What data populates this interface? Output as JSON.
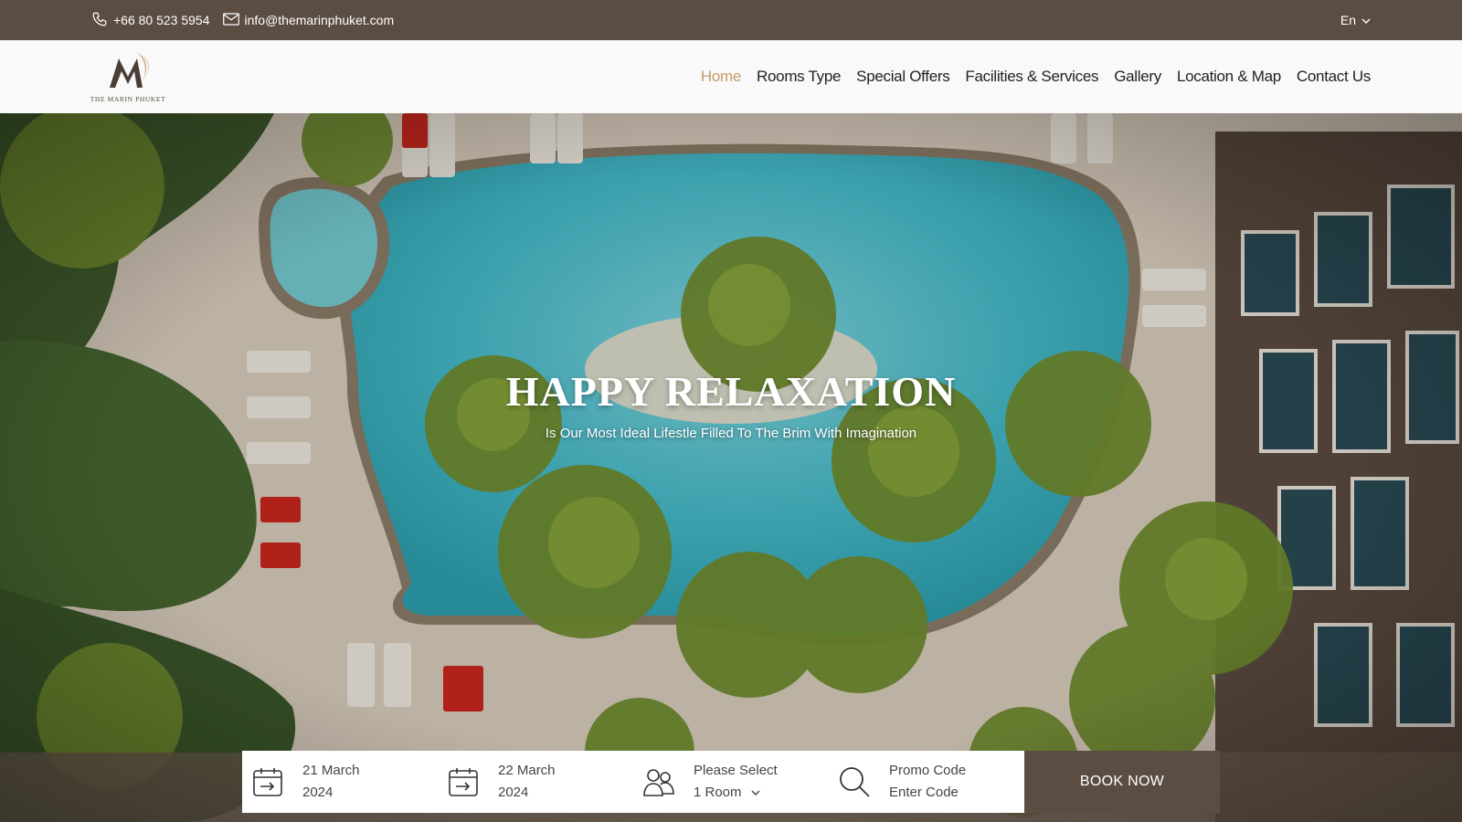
{
  "topbar": {
    "phone": "+66 80 523 5954",
    "email": "info@themarinphuket.com",
    "language": "En"
  },
  "header": {
    "logo_text": "THE MARIN PHUKET",
    "nav": [
      {
        "label": "Home",
        "active": true
      },
      {
        "label": "Rooms Type"
      },
      {
        "label": "Special Offers"
      },
      {
        "label": "Facilities & Services"
      },
      {
        "label": "Gallery"
      },
      {
        "label": "Location & Map"
      },
      {
        "label": "Contact Us"
      }
    ]
  },
  "hero": {
    "title": "HAPPY RELAXATION",
    "subtitle": "Is Our Most Ideal Lifestle Filled To The Brim With Imagination"
  },
  "booking": {
    "checkin": {
      "line1": "21 March",
      "line2": "2024"
    },
    "checkout": {
      "line1": "22 March",
      "line2": "2024"
    },
    "rooms": {
      "line1": "Please Select",
      "line2": "1 Room"
    },
    "promo": {
      "line1": "Promo Code",
      "line2": "Enter Code"
    },
    "button_label": "BOOK NOW"
  },
  "colors": {
    "brand_brown": "#5c4d43",
    "accent_gold": "#c89a6b",
    "pool": "#3fb6c4"
  },
  "icons": [
    "phone-icon",
    "mail-icon",
    "chevron-down-icon",
    "calendar-checkin-icon",
    "calendar-checkout-icon",
    "guests-icon",
    "search-icon"
  ]
}
